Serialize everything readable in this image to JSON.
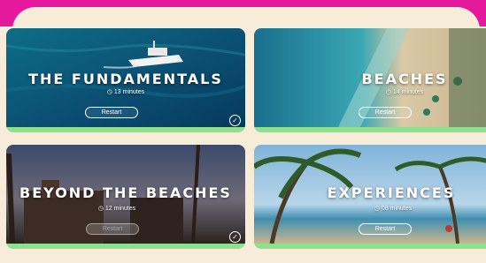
{
  "cards": [
    {
      "title": "THE FUNDAMENTALS",
      "duration": "13 minutes",
      "button": "Restart",
      "completed": true
    },
    {
      "title": "BEACHES",
      "duration": "14 minutes",
      "button": "Restart",
      "completed": false
    },
    {
      "title": "BEYOND THE BEACHES",
      "duration": "12 minutes",
      "button": "Restart",
      "completed": true
    },
    {
      "title": "EXPERIENCES",
      "duration": "08 minutes",
      "button": "Restart",
      "completed": false
    }
  ],
  "icons": {
    "clock": "clock-icon",
    "check": "check-circle-icon"
  },
  "colors": {
    "header": "#e5199b",
    "background": "#f7ecd8",
    "progress": "#8ee08f"
  }
}
